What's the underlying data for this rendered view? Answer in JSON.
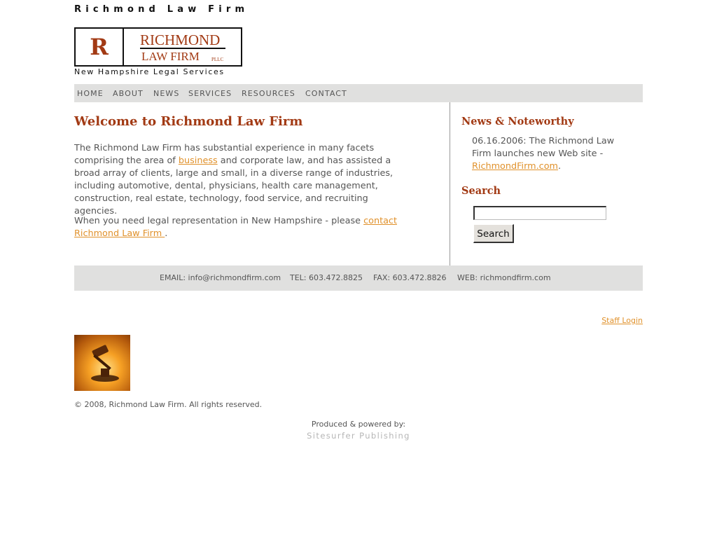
{
  "header": {
    "site_name": "Richmond Law Firm",
    "logo": {
      "monogram": "R",
      "line1": "RICHMOND",
      "line2": "LAW FIRM",
      "line3": "PLLC"
    },
    "tagline": "New Hampshire Legal Services"
  },
  "nav": {
    "items": [
      "HOME",
      "ABOUT",
      "NEWS",
      "SERVICES",
      "RESOURCES",
      "CONTACT"
    ]
  },
  "main": {
    "title": "Welcome to Richmond Law Firm",
    "p1_before": "The Richmond Law Firm has substantial experience in many facets comprising the area of ",
    "p1_link": "business",
    "p1_after": " and corporate law, and has assisted a broad array of clients, large and small, in a diverse range of industries, including automotive, dental, physicians, health care management, construction, real estate, technology, food service, and recruiting agencies.",
    "p2_before": "When you need legal representation in New Hampshire - please ",
    "p2_link": "contact Richmond Law Firm ",
    "p2_after": "."
  },
  "sidebar": {
    "news_title": "News & Noteworthy",
    "news_text": "06.16.2006: The Richmond Law Firm launches new Web site - ",
    "news_link": "RichmondFirm.com",
    "news_after": ".",
    "search_title": "Search",
    "search_value": "",
    "search_button": "Search"
  },
  "contact_bar": {
    "email": "EMAIL: info@richmondfirm.com",
    "tel": "TEL: 603.472.8825",
    "fax": "FAX: 603.472.8826",
    "web": "WEB: richmondfirm.com"
  },
  "footer": {
    "staff_login": "Staff Login",
    "copyright": "© 2008, Richmond Law Firm. All rights reserved.",
    "produced": "Produced & powered by:",
    "publisher": "Sitesurfer Publishing"
  },
  "colors": {
    "accent": "#a23a14",
    "link": "#e0912b",
    "bar": "#e0e0df"
  },
  "icons": [
    "gavel-image"
  ]
}
